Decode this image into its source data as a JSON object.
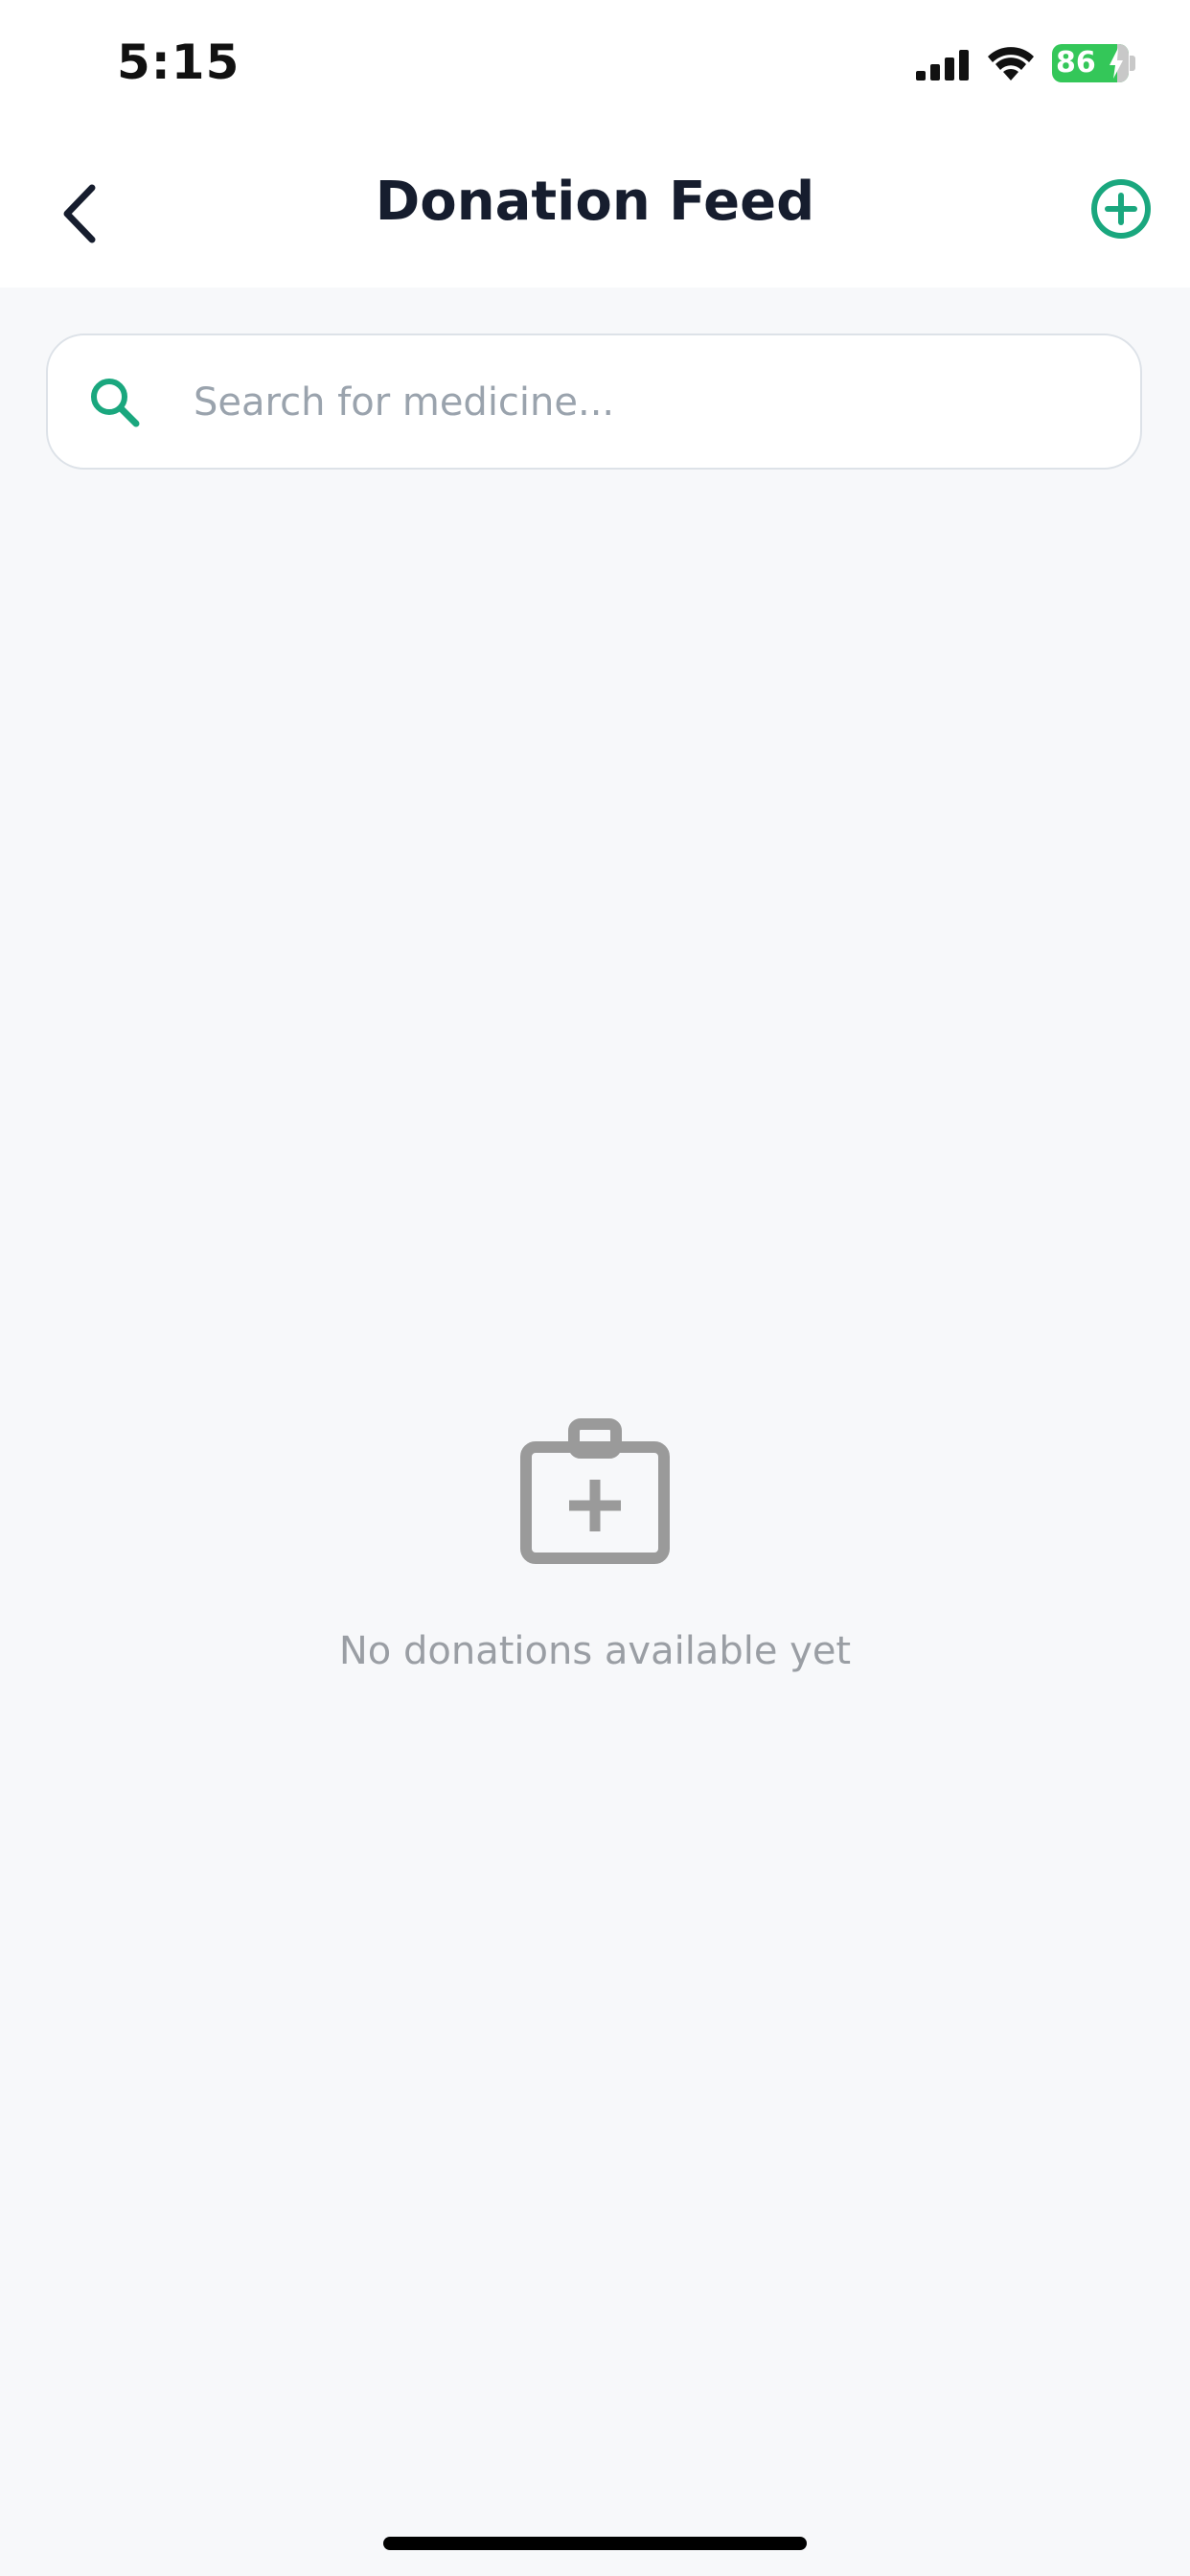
{
  "status_bar": {
    "time": "5:15",
    "battery_level": "86",
    "icons": [
      "signal-icon",
      "wifi-icon",
      "battery-icon"
    ]
  },
  "header": {
    "title": "Donation Feed",
    "back_icon": "chevron-left-icon",
    "add_icon": "plus-circle-icon"
  },
  "search": {
    "placeholder": "Search for medicine...",
    "value": "",
    "icon": "search-icon"
  },
  "empty_state": {
    "icon": "medkit-icon",
    "message": "No donations available yet"
  },
  "colors": {
    "accent": "#1aa77e",
    "title": "#161d2e",
    "empty_gray": "#9a9a9a",
    "battery_green": "#34c759",
    "background": "#f7f8fa"
  }
}
